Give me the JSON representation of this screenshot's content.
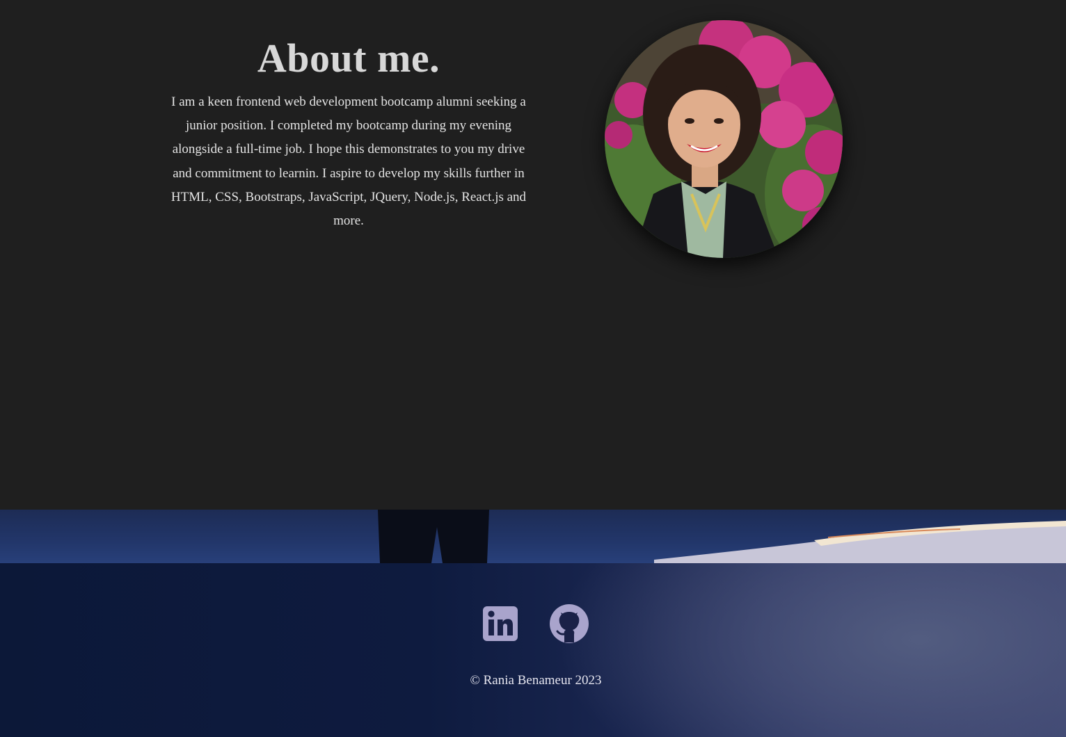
{
  "about": {
    "title": "About me.",
    "body": "I am a keen frontend web development bootcamp alumni seeking a junior position. I completed my bootcamp during my evening alongside a full-time job. I hope this demonstrates to you my drive and commitment to learnin. I aspire to develop my skills further in HTML, CSS, Bootstraps, JavaScript, JQuery, Node.js, React.js and more.",
    "portrait_icon": "profile-photo"
  },
  "footer": {
    "social": [
      {
        "name": "linkedin",
        "icon": "linkedin-icon"
      },
      {
        "name": "github",
        "icon": "github-icon"
      }
    ],
    "copyright": "© Rania Benameur 2023"
  },
  "colors": {
    "background": "#1f1f1f",
    "title": "#d8d8d8",
    "body_text": "#e4e4e4",
    "footer_dark": "#0c1838",
    "social_icon": "#a9a4cc"
  }
}
